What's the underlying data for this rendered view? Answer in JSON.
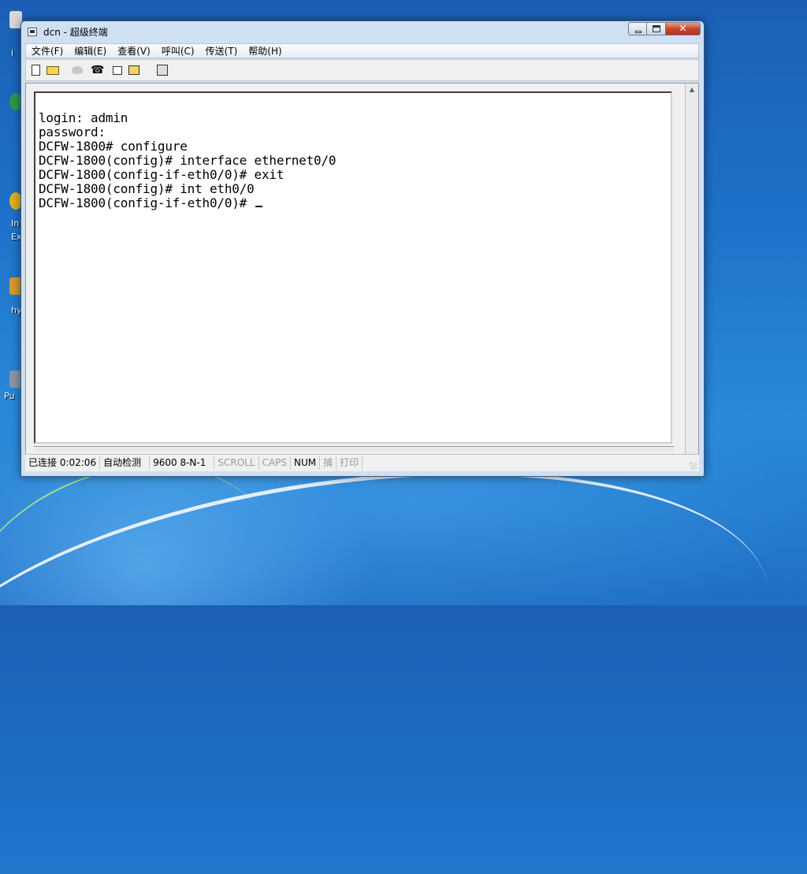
{
  "desktop": {
    "icon_labels": [
      "i",
      "In",
      "Ex",
      "hy",
      "Pu"
    ]
  },
  "window": {
    "title": "dcn - 超级终端",
    "caption": {
      "close_glyph": "✕"
    }
  },
  "menu": {
    "items": [
      "文件(F)",
      "编辑(E)",
      "查看(V)",
      "呼叫(C)",
      "传送(T)",
      "帮助(H)"
    ]
  },
  "toolbar": {
    "icons": [
      "new-icon",
      "open-icon",
      "dial-icon",
      "hangup-icon",
      "send-icon",
      "receive-icon",
      "properties-icon"
    ]
  },
  "terminal": {
    "lines": [
      "login: admin",
      "password:",
      "DCFW-1800# configure",
      "DCFW-1800(config)# interface ethernet0/0",
      "DCFW-1800(config-if-eth0/0)# exit",
      "DCFW-1800(config)# int eth0/0",
      "DCFW-1800(config-if-eth0/0)# "
    ]
  },
  "status": {
    "connection": "已连接 0:02:06",
    "detect": "自动检测",
    "baud": "9600 8-N-1",
    "scroll": "SCROLL",
    "caps": "CAPS",
    "num": "NUM",
    "capture": "捕",
    "print": "打印"
  },
  "colors": {
    "desktop": "#1d71c8",
    "window_frame": "#cfe0f2",
    "close_button": "#c9462c"
  }
}
